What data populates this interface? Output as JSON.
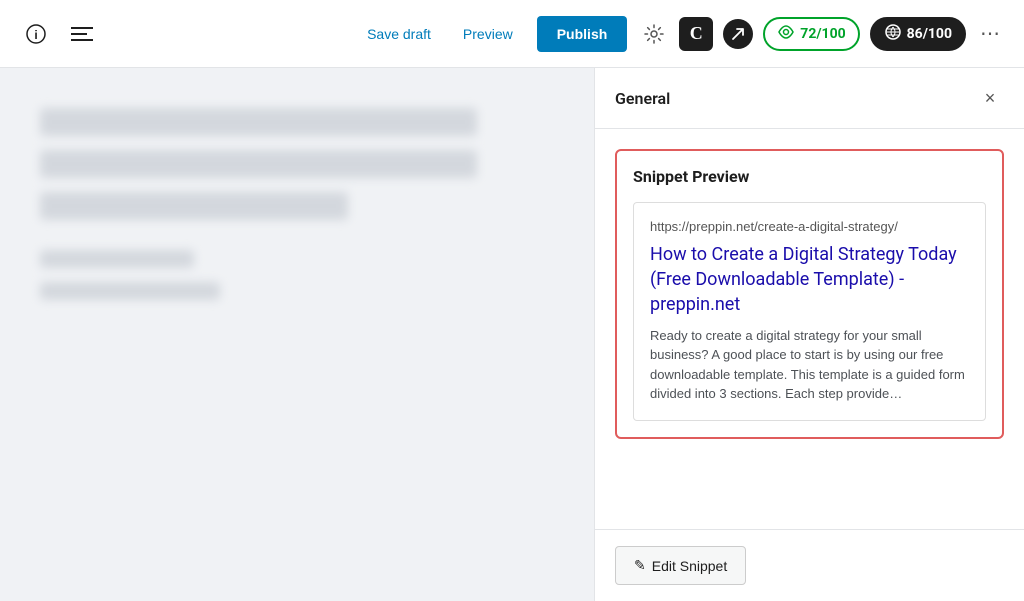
{
  "toolbar": {
    "save_draft_label": "Save draft",
    "preview_label": "Preview",
    "publish_label": "Publish",
    "more_options_label": "⋯"
  },
  "scores": {
    "readability_value": "72/100",
    "seo_value": "86/100"
  },
  "sidebar": {
    "title": "General",
    "close_label": "×"
  },
  "snippet_preview": {
    "section_title": "Snippet Preview",
    "url": "https://preppin.net/create-a-digital-strategy/",
    "page_title": "How to Create a Digital Strategy Today (Free Downloadable Template) - preppin.net",
    "description": "Ready to create a digital strategy for your small business? A good place to start is by using our free downloadable template. This template is a guided form divided into 3 sections. Each step provide…"
  },
  "footer": {
    "edit_snippet_label": "Edit Snippet",
    "edit_icon": "✎"
  }
}
